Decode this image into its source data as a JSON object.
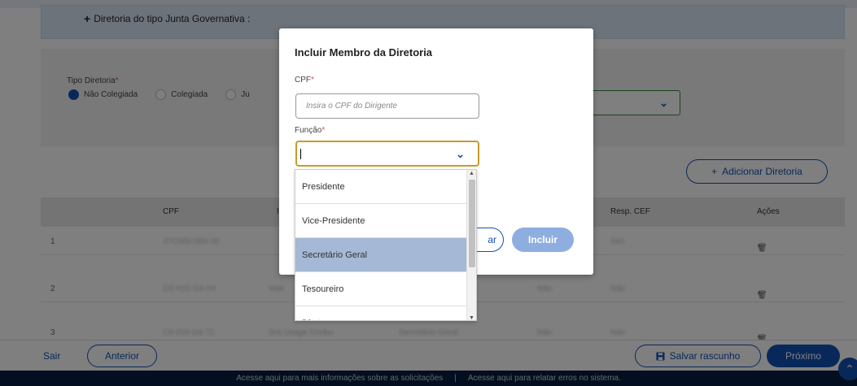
{
  "info": {
    "junta_plus": "+",
    "junta_text": "Diretoria do tipo Junta Governativa :"
  },
  "tipo": {
    "label": "Tipo Diretoria",
    "required_mark": "*",
    "options": [
      "Não Colegiada",
      "Colegiada",
      "Ju"
    ],
    "selected_index": 0
  },
  "add_diretoria": {
    "plus": "+",
    "label": "Adicionar Diretoria"
  },
  "table": {
    "headers": [
      "CPF",
      "I",
      "Resp. CEF",
      "Ações"
    ],
    "rows": [
      {
        "n": "1",
        "cpf": "47C000-084-00",
        "resp": "Sim"
      },
      {
        "n": "2",
        "cpf": "C0-H22-D4-04",
        "nome": "Vale",
        "func": "",
        "x": "Não",
        "resp": "Não"
      },
      {
        "n": "3",
        "cpf": "C0-210-D4-72",
        "nome": "Sra Uoage Cnribu",
        "func": "Secretário Geral",
        "x": "Não",
        "resp": "Não"
      }
    ],
    "edit_icon": "✎",
    "delete_icon": "🗑"
  },
  "footer": {
    "sair": "Sair",
    "anterior": "Anterior",
    "rascunho": "Salvar rascunho",
    "rascunho_icon": "floppy-disk",
    "proximo": "Próximo"
  },
  "bottom": {
    "link1": "Acesse aqui para mais informações sobre as solicitações",
    "sep": "|",
    "link2": "Acesse aqui para relatar erros no sistema."
  },
  "modal": {
    "title": "Incluir Membro da Diretoria",
    "cpf_label": "CPF",
    "cpf_placeholder": "Insira o CPF do Dirigente",
    "funcao_label": "Função",
    "required_mark": "*",
    "cancel_label": "ar",
    "incluir_label": "Incluir"
  },
  "dropdown": {
    "options": [
      "Presidente",
      "Vice-Presidente",
      "Secretário Geral",
      "Tesoureiro",
      "Diretor"
    ],
    "highlighted_index": 2
  },
  "colors": {
    "primary": "#1351b4",
    "focus": "#c69b2a",
    "highlight": "#a5b8d5",
    "footer_dark": "#071d41"
  }
}
